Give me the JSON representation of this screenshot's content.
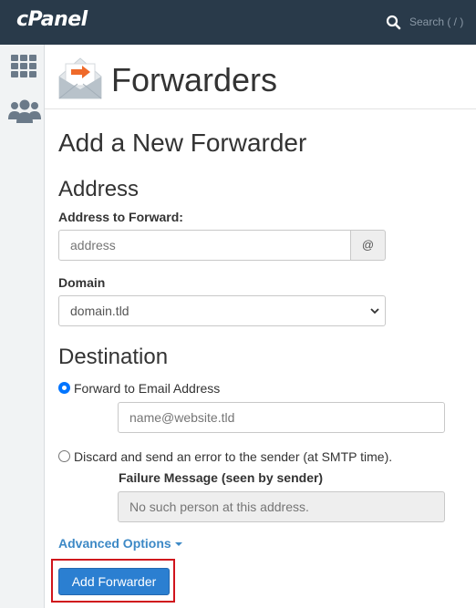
{
  "topbar": {
    "logo": "cPanel",
    "search_placeholder": "Search ( / )",
    "search_icon": "search-icon"
  },
  "sidebar": {
    "icons": [
      "grid-icon",
      "users-icon"
    ]
  },
  "header": {
    "icon": "email-forward-icon",
    "title": "Forwarders"
  },
  "form": {
    "heading": "Add a New Forwarder",
    "address_section": "Address",
    "address_label": "Address to Forward:",
    "address_placeholder": "address",
    "at_symbol": "@",
    "domain_label": "Domain",
    "domain_value": "domain.tld",
    "destination_section": "Destination",
    "forward_option": "Forward to Email Address",
    "forward_placeholder": "name@website.tld",
    "discard_option": "Discard and send an error to the sender (at SMTP time).",
    "failure_label": "Failure Message (seen by sender)",
    "failure_placeholder": "No such person at this address.",
    "advanced_options": "Advanced Options",
    "submit": "Add Forwarder"
  },
  "colors": {
    "topbar": "#293a4a",
    "accent": "#2b7fd1",
    "link": "#3d89c6",
    "highlight": "#d0141c"
  }
}
